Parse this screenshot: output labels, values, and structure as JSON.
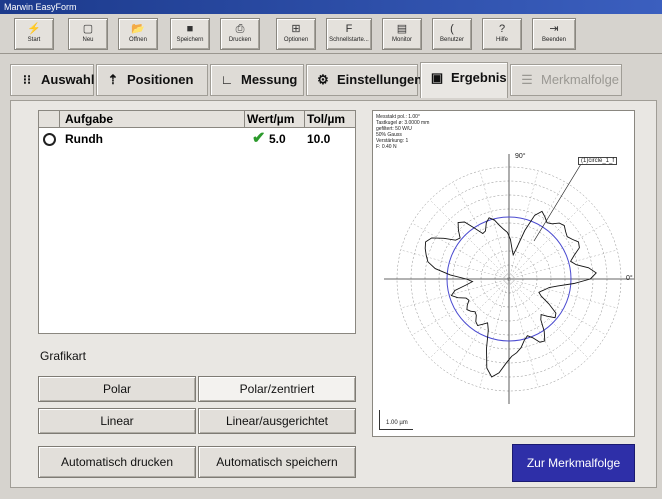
{
  "window": {
    "title": "Marwin EasyForm"
  },
  "toolbar": {
    "buttons": [
      {
        "label": "Start",
        "icon": "start-icon",
        "glyph": "⚡"
      },
      {
        "label": "Neu",
        "icon": "new-icon",
        "glyph": "▢"
      },
      {
        "label": "Öffnen",
        "icon": "open-icon",
        "glyph": "📂"
      },
      {
        "label": "Speichern",
        "icon": "save-icon",
        "glyph": "■"
      },
      {
        "label": "Drucken",
        "icon": "print-icon",
        "glyph": "⎙"
      },
      {
        "label": "Optionen",
        "icon": "options-icon",
        "glyph": "⊞"
      },
      {
        "label": "Schnellstarte...",
        "icon": "quickstart-icon",
        "glyph": "F"
      },
      {
        "label": "Monitor",
        "icon": "monitor-icon",
        "glyph": "▤"
      },
      {
        "label": "Benutzer",
        "icon": "user-icon",
        "glyph": "("
      },
      {
        "label": "Hilfe",
        "icon": "help-icon",
        "glyph": "?"
      },
      {
        "label": "Beenden",
        "icon": "exit-icon",
        "glyph": "⇥"
      }
    ]
  },
  "tabs": [
    {
      "label": "Auswahl",
      "icon": "selection-icon",
      "glyph": "⁝⁝"
    },
    {
      "label": "Positionen",
      "icon": "positions-icon",
      "glyph": "⇡"
    },
    {
      "label": "Messung",
      "icon": "measurement-icon",
      "glyph": "∟"
    },
    {
      "label": "Einstellungen",
      "icon": "settings-icon",
      "glyph": "⚙"
    },
    {
      "label": "Ergebnis",
      "icon": "result-icon",
      "glyph": "▣"
    },
    {
      "label": "Merkmalfolge",
      "icon": "feature-sequence-icon",
      "glyph": "☰"
    }
  ],
  "results_table": {
    "columns": [
      "Aufgabe",
      "Wert/µm",
      "Tol/µm"
    ],
    "rows": [
      {
        "task": "Rundh",
        "value": "5.0",
        "tolerance": "10.0",
        "status": "ok"
      }
    ]
  },
  "graph_type": {
    "label": "Grafikart",
    "options": [
      "Polar",
      "Polar/zentriert",
      "Linear",
      "Linear/ausgerichtet"
    ],
    "selected": "Polar/zentriert"
  },
  "actions": {
    "auto_print": "Automatisch drucken",
    "auto_save": "Automatisch speichern",
    "next": "Zur Merkmalfolge"
  },
  "plot": {
    "info_lines": [
      "Messtakt pol.: 1.00°",
      "Tastkugel ø: 3.0000 mm",
      "gefiltert: 50 W/U",
      "50% Gauss",
      "Verstärkung: 1",
      "F: 0.40 N"
    ],
    "angle_top": "90°",
    "angle_right": "0°",
    "callout": "(1)circle_1_f",
    "scale_label": "1.00 µm"
  },
  "colors": {
    "accent": "#2e2fa8",
    "check": "#2c9a2c",
    "reference_circle": "#4a4ad0"
  }
}
